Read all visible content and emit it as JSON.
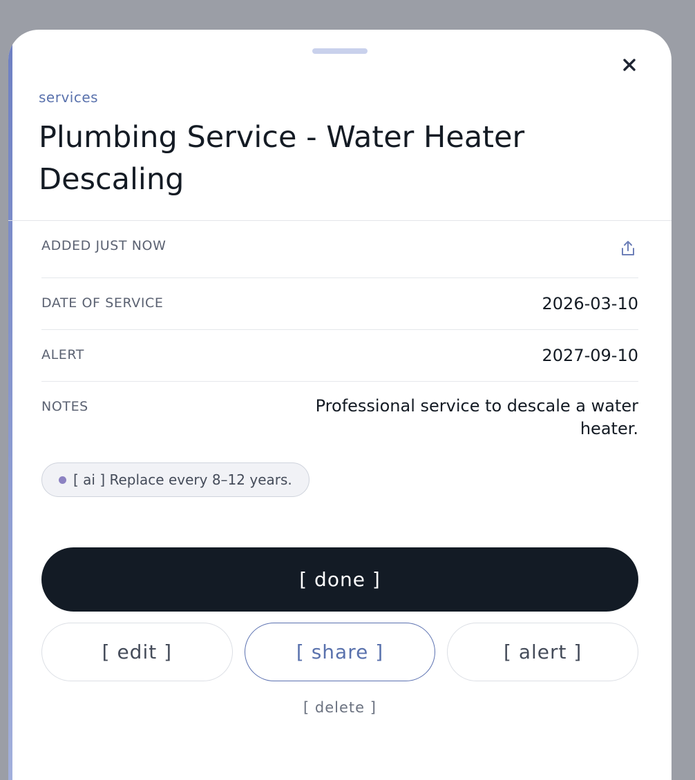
{
  "sheet": {
    "category": "services",
    "title": "Plumbing Service - Water Heater Descaling",
    "close_icon": "close-icon"
  },
  "details": {
    "added_label": "ADDED JUST NOW",
    "share_icon": "share-upload-icon",
    "date_label": "DATE OF SERVICE",
    "date_value": "2026-03-10",
    "alert_label": "ALERT",
    "alert_value": "2027-09-10",
    "notes_label": "NOTES",
    "notes_value": "Professional service to descale a water heater."
  },
  "ai_hint": {
    "text": "[ ai ] Replace every 8–12 years.",
    "dot_color": "#8c82c2"
  },
  "actions": {
    "done_label": "[ done ]",
    "edit_label": "[ edit ]",
    "share_label": "[ share ]",
    "alert_label": "[ alert ]",
    "delete_label": "[ delete ]"
  },
  "colors": {
    "accent": "#5a72ad",
    "primary_button": "#131b25",
    "backdrop": "#9b9ea6"
  }
}
